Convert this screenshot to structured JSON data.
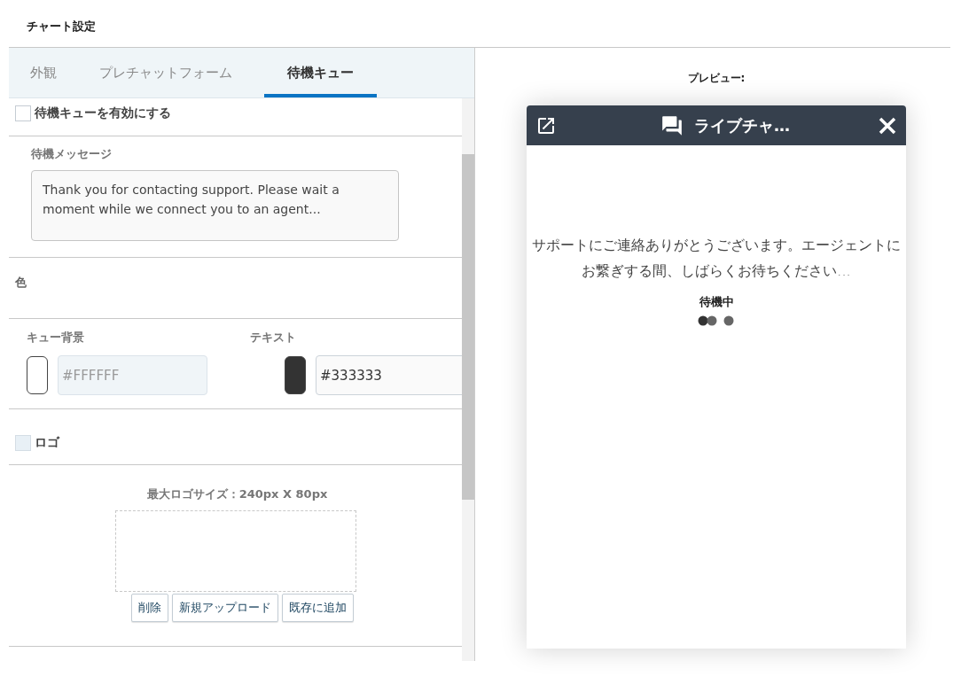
{
  "page_title": "チャート設定",
  "tabs": [
    {
      "label": "外観",
      "selected": false
    },
    {
      "label": "プレチャットフォーム",
      "selected": false
    },
    {
      "label": "待機キュー",
      "selected": true
    }
  ],
  "enable_queue": {
    "label": "待機キューを有効にする",
    "checked": false,
    "disabled": false
  },
  "wait_message": {
    "label": "待機メッセージ",
    "value": "Thank you for contacting support. Please wait a moment while we connect you to an agent..."
  },
  "colors_heading": "色",
  "colors": [
    {
      "label": "キュー背景",
      "value": "#FFFFFF",
      "color": "#ffffff",
      "disabled": true
    },
    {
      "label": "テキスト",
      "value": "#333333",
      "color": "#333333",
      "disabled": false
    }
  ],
  "logo": {
    "label": "ロゴ",
    "checked": false,
    "disabled": true,
    "size_hint": "最大ロゴサイズ：240px X 80px",
    "buttons": [
      "削除",
      "新規アップロード",
      "既存に追加"
    ]
  },
  "preview": {
    "label": "プレビュー:",
    "title": "ライブチャ…",
    "message": "サポートにご連絡ありがとうございます。エージェントにお繋ぎする間、しばらくお待ちください...",
    "status": "待機中"
  }
}
